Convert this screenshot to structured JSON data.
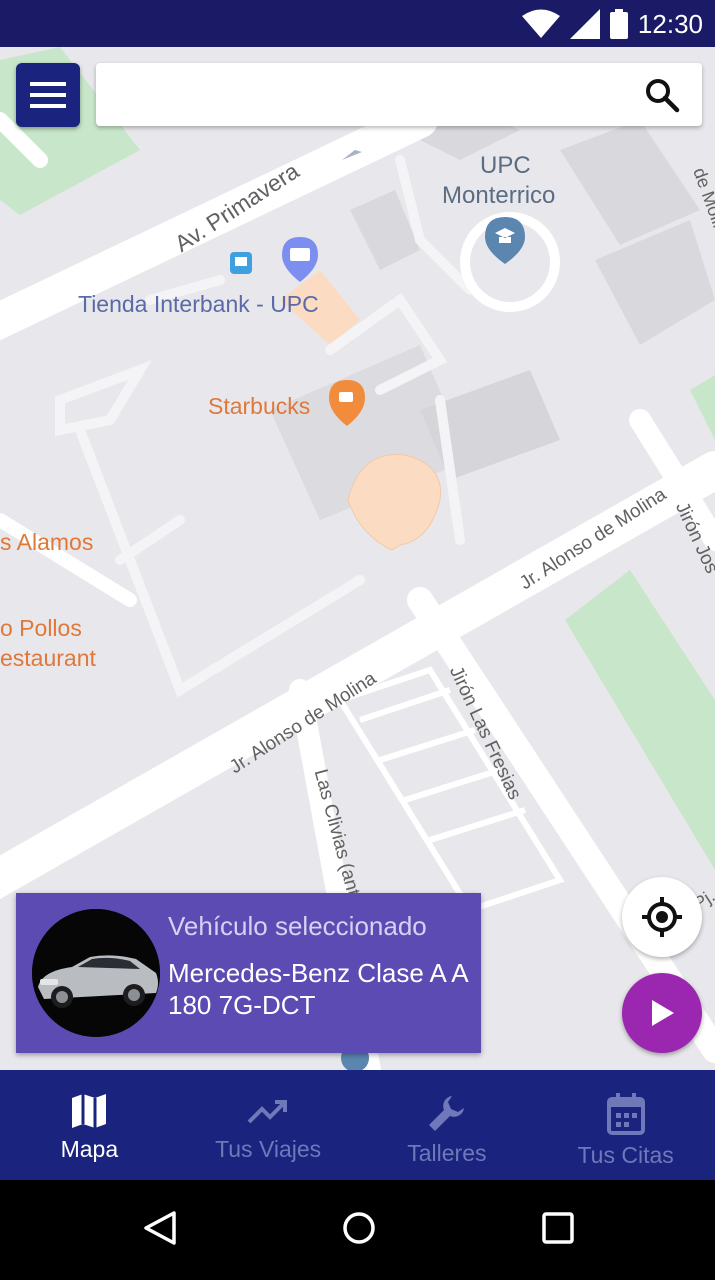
{
  "status_bar": {
    "time": "12:30",
    "icons": [
      "wifi-icon",
      "cell-signal-icon",
      "battery-icon"
    ]
  },
  "top_bar": {
    "menu_icon": "hamburger-menu-icon",
    "search_value": "",
    "search_icon": "search-icon"
  },
  "map": {
    "labels": {
      "street_primavera": "Av. Primavera",
      "poi_upc_line1": "UPC",
      "poi_upc_line2": "Monterrico",
      "poi_interbank": "Tienda Interbank - UPC",
      "poi_starbucks": "Starbucks",
      "street_alonso_1": "Jr. Alonso de Molina",
      "street_alonso_2": "Jr. Alonso de Molina",
      "street_jiron_jos": "Jirón Jos",
      "street_fresias": "Jirón Las Fresias",
      "street_clivias": "Las Clivias (antes C",
      "poi_alamos": "s Alamos",
      "poi_pollos_1": "o Pollos",
      "poi_pollos_2": "estaurant",
      "street_molina_edge": "de Molina",
      "street_pj": "Pj."
    },
    "colors": {
      "background": "#e8e8ec",
      "road": "#ffffff",
      "park": "#c8e6c9",
      "building": "#d9d9dd",
      "campus": "#fbdcc2",
      "poi_orange": "#e8834b",
      "poi_blue": "#4a78a8"
    }
  },
  "vehicle_card": {
    "caption": "Vehículo seleccionado",
    "name": "Mercedes-Benz Clase A A 180 7G-DCT",
    "background": "#5c4bb3"
  },
  "fab": {
    "locate_icon": "my-location-icon",
    "play_icon": "play-icon"
  },
  "bottom_nav": {
    "items": [
      {
        "label": "Mapa",
        "icon": "map-icon",
        "active": true
      },
      {
        "label": "Tus Viajes",
        "icon": "trending-up-icon",
        "active": false
      },
      {
        "label": "Talleres",
        "icon": "wrench-icon",
        "active": false
      },
      {
        "label": "Tus Citas",
        "icon": "calendar-icon",
        "active": false
      }
    ]
  },
  "android_nav": [
    "back-icon",
    "home-icon",
    "recents-icon"
  ]
}
